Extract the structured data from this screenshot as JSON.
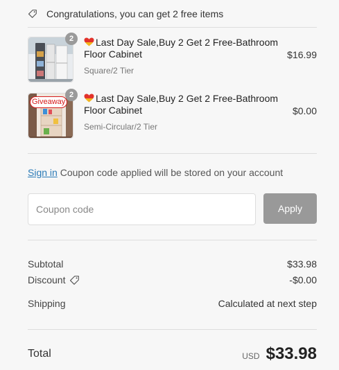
{
  "promo": {
    "text": "Congratulations, you can get 2 free items"
  },
  "items": [
    {
      "title": "Last Day Sale,Buy 2 Get 2 Free-Bathroom Floor Cabinet",
      "variant": "Square/2 Tier",
      "price": "$16.99",
      "quantity": "2",
      "giveaway_label": ""
    },
    {
      "title": "Last Day Sale,Buy 2 Get 2 Free-Bathroom Floor Cabinet",
      "variant": "Semi-Circular/2 Tier",
      "price": "$0.00",
      "quantity": "2",
      "giveaway_label": "Giveaway"
    }
  ],
  "signin": {
    "link_label": "Sign in",
    "text": "Coupon code applied will be stored on your account"
  },
  "coupon": {
    "placeholder": "Coupon code",
    "value": "",
    "apply_label": "Apply"
  },
  "summary": {
    "subtotal_label": "Subtotal",
    "subtotal_value": "$33.98",
    "discount_label": "Discount",
    "discount_value": "-$0.00",
    "shipping_label": "Shipping",
    "shipping_value": "Calculated at next step",
    "total_label": "Total",
    "currency": "USD",
    "total_value": "$33.98"
  },
  "colors": {
    "link": "#2a7ab6",
    "apply_button": "#999999",
    "giveaway": "#d61a1a",
    "badge": "#9a9a9a"
  }
}
